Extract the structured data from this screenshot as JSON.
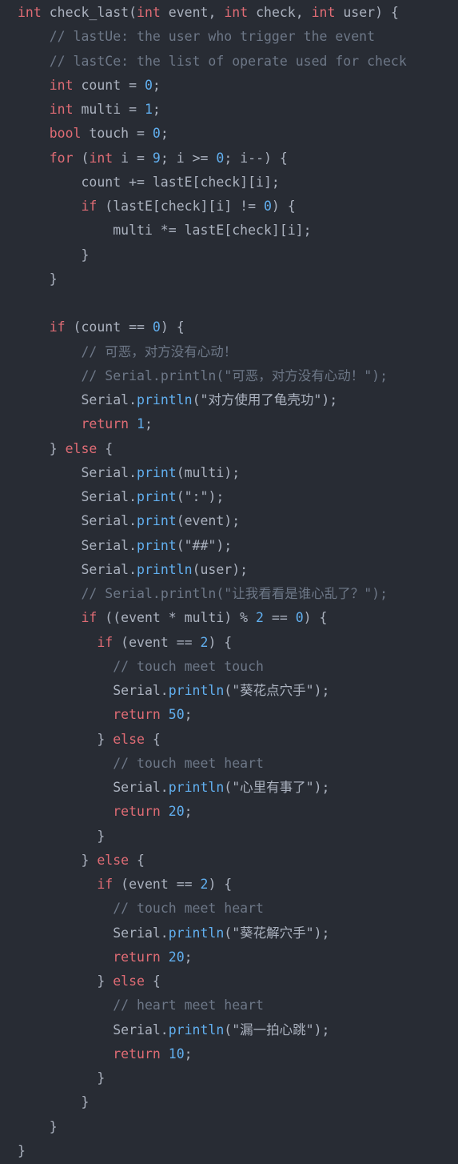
{
  "editor": {
    "theme": {
      "background": "#282c34",
      "plain": "#abb2bf",
      "keyword": "#e06c75",
      "function": "#61afef",
      "number": "#61afef",
      "comment": "#6d7787",
      "string": "#abb2bf"
    },
    "lines": [
      [
        {
          "t": "keyword",
          "v": "int"
        },
        {
          "t": "plain",
          "v": " "
        },
        {
          "t": "ident",
          "v": "check_last"
        },
        {
          "t": "plain",
          "v": "("
        },
        {
          "t": "keyword",
          "v": "int"
        },
        {
          "t": "plain",
          "v": " event, "
        },
        {
          "t": "keyword",
          "v": "int"
        },
        {
          "t": "plain",
          "v": " check, "
        },
        {
          "t": "keyword",
          "v": "int"
        },
        {
          "t": "plain",
          "v": " user) {"
        }
      ],
      [
        {
          "t": "plain",
          "v": "    "
        },
        {
          "t": "comment",
          "v": "// lastUe: the user who trigger the event"
        }
      ],
      [
        {
          "t": "plain",
          "v": "    "
        },
        {
          "t": "comment",
          "v": "// lastCe: the list of operate used for check"
        }
      ],
      [
        {
          "t": "plain",
          "v": "    "
        },
        {
          "t": "keyword",
          "v": "int"
        },
        {
          "t": "plain",
          "v": " count = "
        },
        {
          "t": "number",
          "v": "0"
        },
        {
          "t": "plain",
          "v": ";"
        }
      ],
      [
        {
          "t": "plain",
          "v": "    "
        },
        {
          "t": "keyword",
          "v": "int"
        },
        {
          "t": "plain",
          "v": " multi = "
        },
        {
          "t": "number",
          "v": "1"
        },
        {
          "t": "plain",
          "v": ";"
        }
      ],
      [
        {
          "t": "plain",
          "v": "    "
        },
        {
          "t": "keyword",
          "v": "bool"
        },
        {
          "t": "plain",
          "v": " touch = "
        },
        {
          "t": "number",
          "v": "0"
        },
        {
          "t": "plain",
          "v": ";"
        }
      ],
      [
        {
          "t": "plain",
          "v": "    "
        },
        {
          "t": "keyword",
          "v": "for"
        },
        {
          "t": "plain",
          "v": " ("
        },
        {
          "t": "keyword",
          "v": "int"
        },
        {
          "t": "plain",
          "v": " i = "
        },
        {
          "t": "number",
          "v": "9"
        },
        {
          "t": "plain",
          "v": "; i >= "
        },
        {
          "t": "number",
          "v": "0"
        },
        {
          "t": "plain",
          "v": "; i--) {"
        }
      ],
      [
        {
          "t": "plain",
          "v": "        count += lastE[check][i];"
        }
      ],
      [
        {
          "t": "plain",
          "v": "        "
        },
        {
          "t": "keyword",
          "v": "if"
        },
        {
          "t": "plain",
          "v": " (lastE[check][i] != "
        },
        {
          "t": "number",
          "v": "0"
        },
        {
          "t": "plain",
          "v": ") {"
        }
      ],
      [
        {
          "t": "plain",
          "v": "            multi *= lastE[check][i];"
        }
      ],
      [
        {
          "t": "plain",
          "v": "        }"
        }
      ],
      [
        {
          "t": "plain",
          "v": "    }"
        }
      ],
      [
        {
          "t": "plain",
          "v": ""
        }
      ],
      [
        {
          "t": "plain",
          "v": "    "
        },
        {
          "t": "keyword",
          "v": "if"
        },
        {
          "t": "plain",
          "v": " (count == "
        },
        {
          "t": "number",
          "v": "0"
        },
        {
          "t": "plain",
          "v": ") {"
        }
      ],
      [
        {
          "t": "plain",
          "v": "        "
        },
        {
          "t": "comment",
          "v": "// 可恶，对方没有心动！"
        }
      ],
      [
        {
          "t": "plain",
          "v": "        "
        },
        {
          "t": "comment",
          "v": "// Serial.println(\"可恶，对方没有心动！\");"
        }
      ],
      [
        {
          "t": "plain",
          "v": "        Serial."
        },
        {
          "t": "function",
          "v": "println"
        },
        {
          "t": "plain",
          "v": "("
        },
        {
          "t": "string",
          "v": "\"对方使用了龟壳功\""
        },
        {
          "t": "plain",
          "v": ");"
        }
      ],
      [
        {
          "t": "plain",
          "v": "        "
        },
        {
          "t": "keyword",
          "v": "return"
        },
        {
          "t": "plain",
          "v": " "
        },
        {
          "t": "number",
          "v": "1"
        },
        {
          "t": "plain",
          "v": ";"
        }
      ],
      [
        {
          "t": "plain",
          "v": "    } "
        },
        {
          "t": "keyword",
          "v": "else"
        },
        {
          "t": "plain",
          "v": " {"
        }
      ],
      [
        {
          "t": "plain",
          "v": "        Serial."
        },
        {
          "t": "function",
          "v": "print"
        },
        {
          "t": "plain",
          "v": "(multi);"
        }
      ],
      [
        {
          "t": "plain",
          "v": "        Serial."
        },
        {
          "t": "function",
          "v": "print"
        },
        {
          "t": "plain",
          "v": "("
        },
        {
          "t": "string",
          "v": "\":\""
        },
        {
          "t": "plain",
          "v": ");"
        }
      ],
      [
        {
          "t": "plain",
          "v": "        Serial."
        },
        {
          "t": "function",
          "v": "print"
        },
        {
          "t": "plain",
          "v": "(event);"
        }
      ],
      [
        {
          "t": "plain",
          "v": "        Serial."
        },
        {
          "t": "function",
          "v": "print"
        },
        {
          "t": "plain",
          "v": "("
        },
        {
          "t": "string",
          "v": "\"##\""
        },
        {
          "t": "plain",
          "v": ");"
        }
      ],
      [
        {
          "t": "plain",
          "v": "        Serial."
        },
        {
          "t": "function",
          "v": "println"
        },
        {
          "t": "plain",
          "v": "(user);"
        }
      ],
      [
        {
          "t": "plain",
          "v": "        "
        },
        {
          "t": "comment",
          "v": "// Serial.println(\"让我看看是谁心乱了？\");"
        }
      ],
      [
        {
          "t": "plain",
          "v": "        "
        },
        {
          "t": "keyword",
          "v": "if"
        },
        {
          "t": "plain",
          "v": " ((event * multi) % "
        },
        {
          "t": "number",
          "v": "2"
        },
        {
          "t": "plain",
          "v": " == "
        },
        {
          "t": "number",
          "v": "0"
        },
        {
          "t": "plain",
          "v": ") {"
        }
      ],
      [
        {
          "t": "plain",
          "v": "          "
        },
        {
          "t": "keyword",
          "v": "if"
        },
        {
          "t": "plain",
          "v": " (event == "
        },
        {
          "t": "number",
          "v": "2"
        },
        {
          "t": "plain",
          "v": ") {"
        }
      ],
      [
        {
          "t": "plain",
          "v": "            "
        },
        {
          "t": "comment",
          "v": "// touch meet touch"
        }
      ],
      [
        {
          "t": "plain",
          "v": "            Serial."
        },
        {
          "t": "function",
          "v": "println"
        },
        {
          "t": "plain",
          "v": "("
        },
        {
          "t": "string",
          "v": "\"葵花点穴手\""
        },
        {
          "t": "plain",
          "v": ");"
        }
      ],
      [
        {
          "t": "plain",
          "v": "            "
        },
        {
          "t": "keyword",
          "v": "return"
        },
        {
          "t": "plain",
          "v": " "
        },
        {
          "t": "number",
          "v": "50"
        },
        {
          "t": "plain",
          "v": ";"
        }
      ],
      [
        {
          "t": "plain",
          "v": "          } "
        },
        {
          "t": "keyword",
          "v": "else"
        },
        {
          "t": "plain",
          "v": " {"
        }
      ],
      [
        {
          "t": "plain",
          "v": "            "
        },
        {
          "t": "comment",
          "v": "// touch meet heart"
        }
      ],
      [
        {
          "t": "plain",
          "v": "            Serial."
        },
        {
          "t": "function",
          "v": "println"
        },
        {
          "t": "plain",
          "v": "("
        },
        {
          "t": "string",
          "v": "\"心里有事了\""
        },
        {
          "t": "plain",
          "v": ");"
        }
      ],
      [
        {
          "t": "plain",
          "v": "            "
        },
        {
          "t": "keyword",
          "v": "return"
        },
        {
          "t": "plain",
          "v": " "
        },
        {
          "t": "number",
          "v": "20"
        },
        {
          "t": "plain",
          "v": ";"
        }
      ],
      [
        {
          "t": "plain",
          "v": "          }"
        }
      ],
      [
        {
          "t": "plain",
          "v": "        } "
        },
        {
          "t": "keyword",
          "v": "else"
        },
        {
          "t": "plain",
          "v": " {"
        }
      ],
      [
        {
          "t": "plain",
          "v": "          "
        },
        {
          "t": "keyword",
          "v": "if"
        },
        {
          "t": "plain",
          "v": " (event == "
        },
        {
          "t": "number",
          "v": "2"
        },
        {
          "t": "plain",
          "v": ") {"
        }
      ],
      [
        {
          "t": "plain",
          "v": "            "
        },
        {
          "t": "comment",
          "v": "// touch meet heart"
        }
      ],
      [
        {
          "t": "plain",
          "v": "            Serial."
        },
        {
          "t": "function",
          "v": "println"
        },
        {
          "t": "plain",
          "v": "("
        },
        {
          "t": "string",
          "v": "\"葵花解穴手\""
        },
        {
          "t": "plain",
          "v": ");"
        }
      ],
      [
        {
          "t": "plain",
          "v": "            "
        },
        {
          "t": "keyword",
          "v": "return"
        },
        {
          "t": "plain",
          "v": " "
        },
        {
          "t": "number",
          "v": "20"
        },
        {
          "t": "plain",
          "v": ";"
        }
      ],
      [
        {
          "t": "plain",
          "v": "          } "
        },
        {
          "t": "keyword",
          "v": "else"
        },
        {
          "t": "plain",
          "v": " {"
        }
      ],
      [
        {
          "t": "plain",
          "v": "            "
        },
        {
          "t": "comment",
          "v": "// heart meet heart"
        }
      ],
      [
        {
          "t": "plain",
          "v": "            Serial."
        },
        {
          "t": "function",
          "v": "println"
        },
        {
          "t": "plain",
          "v": "("
        },
        {
          "t": "string",
          "v": "\"漏一拍心跳\""
        },
        {
          "t": "plain",
          "v": ");"
        }
      ],
      [
        {
          "t": "plain",
          "v": "            "
        },
        {
          "t": "keyword",
          "v": "return"
        },
        {
          "t": "plain",
          "v": " "
        },
        {
          "t": "number",
          "v": "10"
        },
        {
          "t": "plain",
          "v": ";"
        }
      ],
      [
        {
          "t": "plain",
          "v": "          }"
        }
      ],
      [
        {
          "t": "plain",
          "v": "        }"
        }
      ],
      [
        {
          "t": "plain",
          "v": "    }"
        }
      ],
      [
        {
          "t": "plain",
          "v": "}"
        }
      ]
    ]
  }
}
